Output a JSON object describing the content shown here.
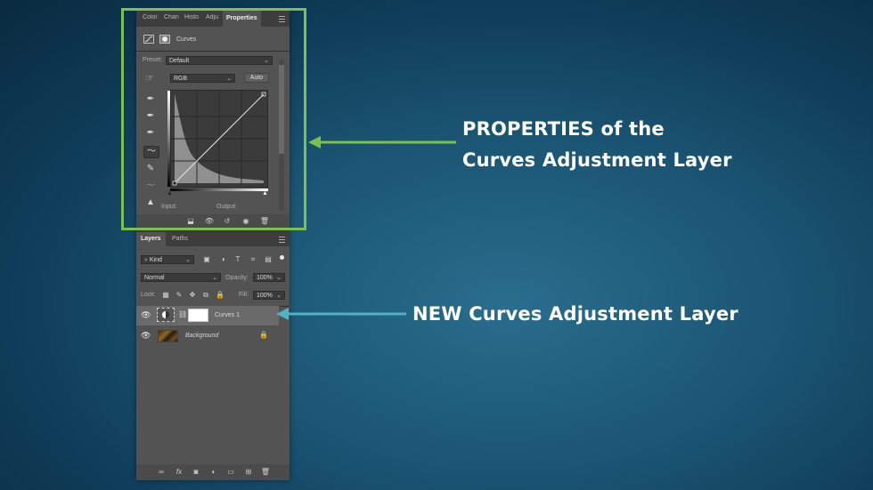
{
  "colors": {
    "highlight_green": "#7cc14f",
    "highlight_teal": "#4fb3c8",
    "panel_bg": "#535353"
  },
  "properties_panel": {
    "tabs": [
      "Color",
      "Chan",
      "Histo",
      "Adju",
      "Properties"
    ],
    "active_tab": "Properties",
    "header_label": "Curves",
    "preset_label": "Preset:",
    "preset_value": "Default",
    "channel_value": "RGB",
    "auto_label": "Auto",
    "input_label": "Input:",
    "output_label": "Output:"
  },
  "layers_panel": {
    "tabs": [
      "Layers",
      "Paths"
    ],
    "active_tab": "Layers",
    "filter_label": "Kind",
    "blend_mode": "Normal",
    "opacity_label": "Opacity:",
    "opacity_value": "100%",
    "lock_label": "Lock:",
    "fill_label": "Fill:",
    "fill_value": "100%",
    "layers": [
      {
        "name": "Curves 1",
        "selected": true,
        "visible": true
      },
      {
        "name": "Background",
        "selected": false,
        "visible": true,
        "locked": true
      }
    ]
  },
  "annotations": {
    "properties_line1": "PROPERTIES of the",
    "properties_line2": "Curves Adjustment Layer",
    "new_layer": "NEW Curves Adjustment Layer"
  }
}
